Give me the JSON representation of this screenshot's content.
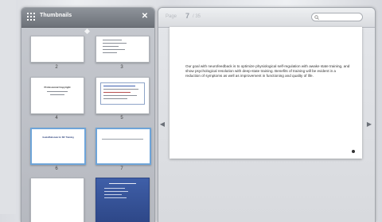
{
  "thumbnails": {
    "title": "Thumbnails",
    "items": [
      {
        "number": "2"
      },
      {
        "number": "3"
      },
      {
        "number": "4",
        "heading": "Professional Copyright"
      },
      {
        "number": "5"
      },
      {
        "number": "6",
        "heading": "Goals/Rationale for ISF Training"
      },
      {
        "number": "7"
      },
      {
        "number": ""
      },
      {
        "number": ""
      }
    ]
  },
  "viewer": {
    "page_label": "Page",
    "page_number": "7",
    "page_of": "/ 35",
    "search_placeholder": "",
    "body_text": "Our goal with neurofeedback is to optimize physiological self-regulation with awake state training, and show psychological resolution with deep-state training. Benefits of training will be evident in a reduction of symptoms as well as improvement in functioning and quality of life."
  },
  "colors": {
    "selection": "#6ea4d8",
    "header_dark": "#6d7279"
  },
  "icons": [
    "grid-icon",
    "close-icon",
    "chevron-up-icon",
    "search-icon",
    "chevron-left-icon",
    "chevron-right-icon"
  ]
}
